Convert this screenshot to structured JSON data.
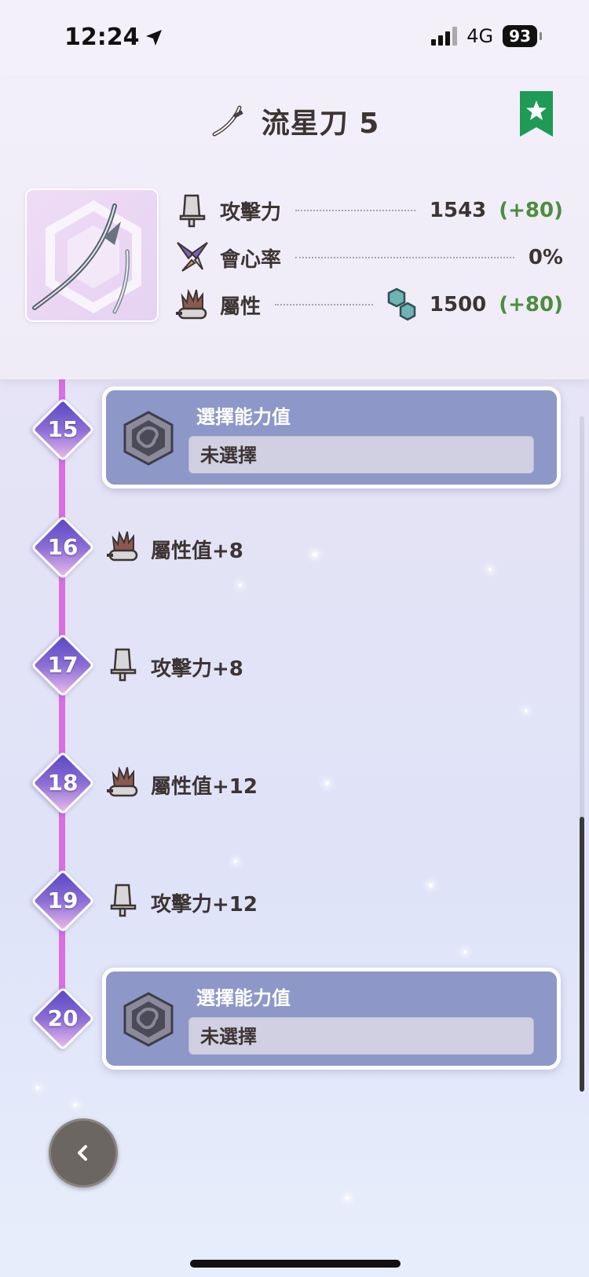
{
  "status_bar": {
    "time": "12:24",
    "network": "4G",
    "battery": "93"
  },
  "header": {
    "title": "流星刀 5",
    "bookmark_color": "#1f9a57",
    "weapon_icon": "long-sword-icon"
  },
  "stats": [
    {
      "label": "攻擊力",
      "value": "1543",
      "bonus": "(+80)",
      "icon": "attack-icon"
    },
    {
      "label": "會心率",
      "value": "0%",
      "bonus": "",
      "icon": "affinity-icon"
    },
    {
      "label": "屬性",
      "value": "1500",
      "bonus": "(+80)",
      "icon": "element-icon",
      "element_icon": "water-element-icon"
    }
  ],
  "levels": [
    {
      "num": "15",
      "type": "choice",
      "title": "選擇能力值",
      "value": "未選擇"
    },
    {
      "num": "16",
      "type": "stat",
      "text": "屬性值+8",
      "icon": "element-icon"
    },
    {
      "num": "17",
      "type": "stat",
      "text": "攻擊力+8",
      "icon": "attack-icon"
    },
    {
      "num": "18",
      "type": "stat",
      "text": "屬性值+12",
      "icon": "element-icon"
    },
    {
      "num": "19",
      "type": "stat",
      "text": "攻擊力+12",
      "icon": "attack-icon"
    },
    {
      "num": "20",
      "type": "choice",
      "title": "選擇能力值",
      "value": "未選擇"
    }
  ],
  "colors": {
    "timeline": "#d86fe2",
    "card": "#8d97c8",
    "bonus": "#4d8d3e"
  }
}
